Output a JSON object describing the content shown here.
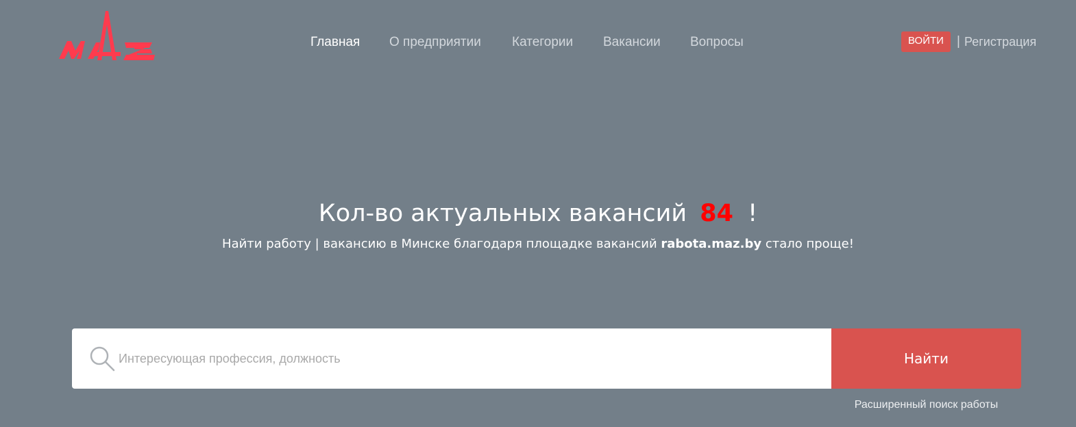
{
  "header": {
    "logo_icon": "maz-logo-icon",
    "brand_color": "#ff3b4e",
    "nav": {
      "home": "Главная",
      "about": "О предприятии",
      "categories": "Категории",
      "vacancies": "Вакансии",
      "faq": "Вопросы"
    },
    "auth": {
      "login_label": "ВОЙТИ",
      "separator": "|",
      "register_label": "Регистрация"
    }
  },
  "hero": {
    "title_prefix": "Кол-во актуальных вакансий",
    "vacancy_count": "84",
    "title_suffix": "!",
    "subtitle_prefix": "Найти работу | вакансию в Минске благодаря площадке вакансий",
    "subtitle_site": "rabota.maz.by",
    "subtitle_suffix": "стало проще!"
  },
  "search": {
    "icon": "search-icon",
    "value": "",
    "placeholder": "Интересующая профессия, должность",
    "button_label": "Найти",
    "advanced_label": "Расширенный поиск работы",
    "accent_color": "#d9534f"
  }
}
